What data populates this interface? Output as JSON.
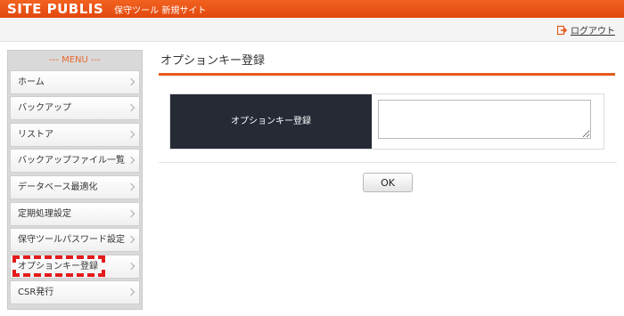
{
  "header": {
    "brand": "SITE PUBLIS",
    "subtitle": "保守ツール 新規サイト"
  },
  "topbar": {
    "logout_label": "ログアウト",
    "logout_icon": "logout-icon"
  },
  "sidebar": {
    "title": "--- MENU ---",
    "items": [
      {
        "label": "ホーム"
      },
      {
        "label": "バックアップ"
      },
      {
        "label": "リストア"
      },
      {
        "label": "バックアップファイル一覧"
      },
      {
        "label": "データベース最適化"
      },
      {
        "label": "定期処理設定"
      },
      {
        "label": "保守ツールパスワード設定"
      },
      {
        "label": "オプションキー登録",
        "highlighted": true
      },
      {
        "label": "CSR発行"
      }
    ]
  },
  "main": {
    "title": "オプションキー登録",
    "form": {
      "field_label": "オプションキー登録",
      "field_value": ""
    },
    "ok_label": "OK"
  },
  "colors": {
    "header": "#e85a1a",
    "accent": "#e55a1c",
    "label_bg": "#252a35",
    "highlight_border": "#e41b1b"
  }
}
